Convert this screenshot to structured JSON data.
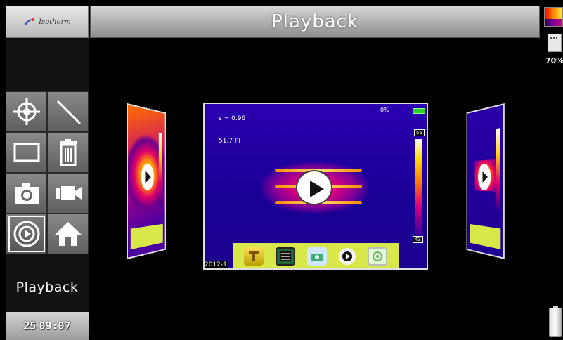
{
  "header": {
    "title": "Playback"
  },
  "logo": {
    "text": "Isotherm",
    "icon": "brand-logo-icon"
  },
  "left_panel": {
    "tools": [
      {
        "name": "spot-measure",
        "icon": "crosshair-icon"
      },
      {
        "name": "line-measure",
        "icon": "line-icon"
      },
      {
        "name": "area-measure",
        "icon": "rectangle-icon"
      },
      {
        "name": "delete",
        "icon": "trash-icon"
      },
      {
        "name": "photo",
        "icon": "camera-icon"
      },
      {
        "name": "video",
        "icon": "video-camera-icon"
      },
      {
        "name": "playback",
        "icon": "play-circle-icon",
        "selected": true
      },
      {
        "name": "home",
        "icon": "home-icon"
      }
    ],
    "mode_label": "Playback",
    "date_day": "25",
    "time": "09:07"
  },
  "right_status": {
    "palette": "iron-palette",
    "storage_icon": "sd-card-icon",
    "storage_percent": "70%",
    "battery_icon": "battery-icon"
  },
  "main_card": {
    "emissivity": "ε = 0.96",
    "reading": "51.7 PI",
    "storage": "0%",
    "scale_max": "55",
    "scale_min": "43",
    "date": "2012-1",
    "toolbar": [
      {
        "name": "thermal-mode",
        "icon": "thermal-mode-icon"
      },
      {
        "name": "film",
        "icon": "film-icon"
      },
      {
        "name": "camera",
        "icon": "camera-icon"
      },
      {
        "name": "play",
        "icon": "play-icon"
      },
      {
        "name": "settings",
        "icon": "settings-icon"
      }
    ]
  },
  "colors": {
    "toolbar_bg": "#d8e84a",
    "thermal_bg": "#1a0094",
    "hot": "#ff2a9a"
  }
}
